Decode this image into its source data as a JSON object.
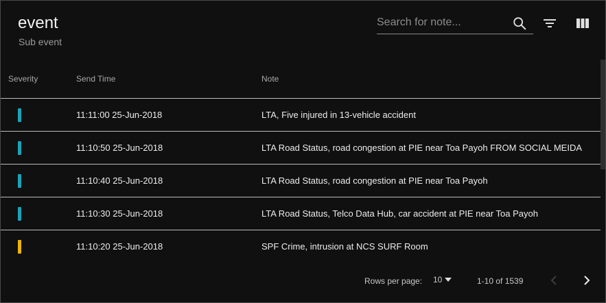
{
  "header": {
    "title": "event",
    "subtitle": "Sub event",
    "search_placeholder": "Search for note..."
  },
  "icons": {
    "search": "search-icon",
    "filter": "filter-icon",
    "columns": "view-columns-icon",
    "dropdown": "arrow-drop-down-icon",
    "prev": "chevron-left-icon",
    "next": "chevron-right-icon"
  },
  "table": {
    "columns": [
      "Severity",
      "Send Time",
      "Note"
    ],
    "rows": [
      {
        "severity_color": "#1aa3b8",
        "time": "11:11:00 25-Jun-2018",
        "note": "LTA, Five injured in 13-vehicle accident"
      },
      {
        "severity_color": "#1aa3b8",
        "time": "11:10:50 25-Jun-2018",
        "note": "LTA Road Status, road congestion at PIE near Toa Payoh FROM SOCIAL MEIDA"
      },
      {
        "severity_color": "#1aa3b8",
        "time": "11:10:40 25-Jun-2018",
        "note": "LTA Road Status, road congestion at PIE near Toa Payoh"
      },
      {
        "severity_color": "#1aa3b8",
        "time": "11:10:30 25-Jun-2018",
        "note": "LTA Road Status, Telco Data Hub, car accident at PIE near Toa Payoh"
      },
      {
        "severity_color": "#f0b400",
        "time": "11:10:20 25-Jun-2018",
        "note": "SPF Crime, intrusion at NCS SURF Room"
      }
    ]
  },
  "footer": {
    "rows_per_page_label": "Rows per page:",
    "rows_per_page_value": "10",
    "range_text": "1-10 of 1539"
  },
  "colors": {
    "background": "#101010",
    "divider": "#bdbdbd",
    "severity_info": "#1aa3b8",
    "severity_warning": "#f0b400"
  }
}
